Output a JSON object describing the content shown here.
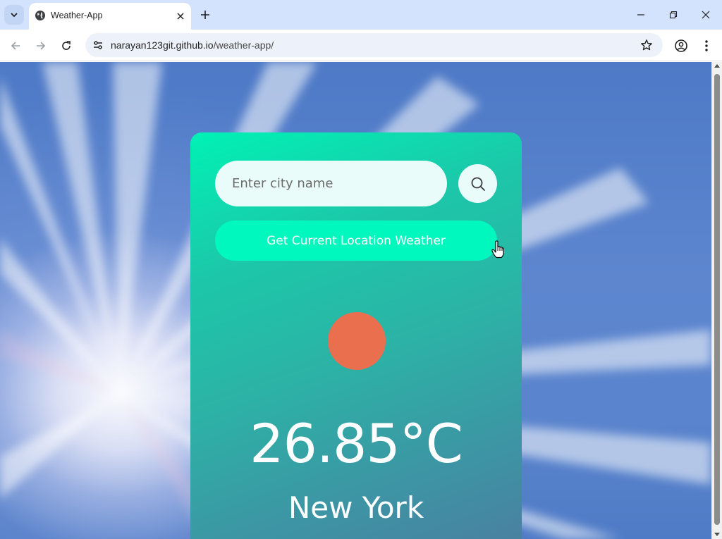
{
  "browser": {
    "tab_title": "Weather-App",
    "url_host": "narayan123git.github.io",
    "url_path": "/weather-app/"
  },
  "app": {
    "search_placeholder": "Enter city name",
    "location_button_label": "Get Current Location Weather",
    "temperature": "26.85°C",
    "city": "New York",
    "weather_icon": "sun-icon",
    "colors": {
      "card_top": "#00f2b6",
      "card_bottom": "#4b7ea0",
      "location_button": "#00f7bd",
      "sun": "#ea6f4f",
      "input_bg": "#e9fcfa"
    }
  }
}
